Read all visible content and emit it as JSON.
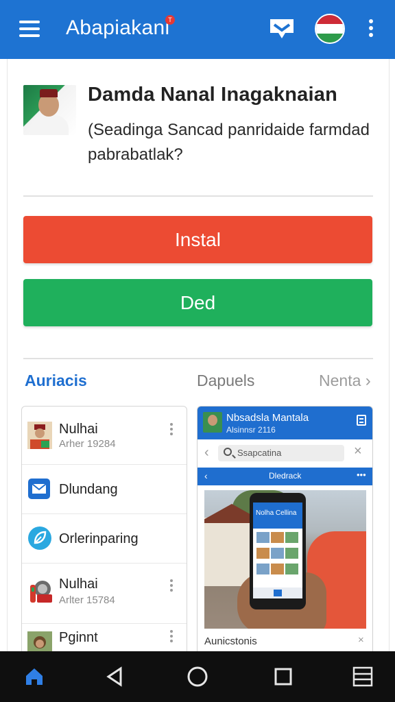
{
  "app_bar": {
    "title": "Abapiakani",
    "badge": "T",
    "color": "#1e73d2",
    "icons": [
      "menu-icon",
      "chat-icon",
      "flag-avatar",
      "more-vert-icon"
    ]
  },
  "post": {
    "headline": "Damda Nanal Inagaknaian",
    "question": "(Seadinga Sancad panridaide farmdad pabrabatlak?"
  },
  "buttons": {
    "install_label": "Instal",
    "install_color": "#ec4b33",
    "ded_label": "Ded",
    "ded_color": "#1fb05c"
  },
  "tabs": {
    "active": "Auriacis",
    "middle": "Dapuels",
    "next": "Nenta"
  },
  "list": {
    "items": [
      {
        "title": "Nulhai",
        "subtitle": "Arher 19284",
        "icon": "person-avatar"
      },
      {
        "title": "Dlundang",
        "subtitle": "",
        "icon": "mail-icon"
      },
      {
        "title": "Orlerinparing",
        "subtitle": "",
        "icon": "leaf-icon"
      },
      {
        "title": "Nulhai",
        "subtitle": "Arlter 15784",
        "icon": "camera-icon"
      },
      {
        "title": "Pginnt",
        "subtitle": "",
        "icon": "person-avatar"
      }
    ]
  },
  "preview": {
    "header_title": "Nbsadsla Mantala",
    "header_sub": "Alsinnsr 2116",
    "search_placeholder": "Ssapcatina",
    "subbar_title": "Dledrack",
    "subbar_dots": "•••",
    "phone_screen_title": "Nolha Cellina",
    "caption": "Aunicstonis"
  },
  "navbar": {
    "icons": [
      "home-icon",
      "back-icon",
      "home-circle-icon",
      "recents-icon",
      "menu-lines-icon"
    ]
  }
}
